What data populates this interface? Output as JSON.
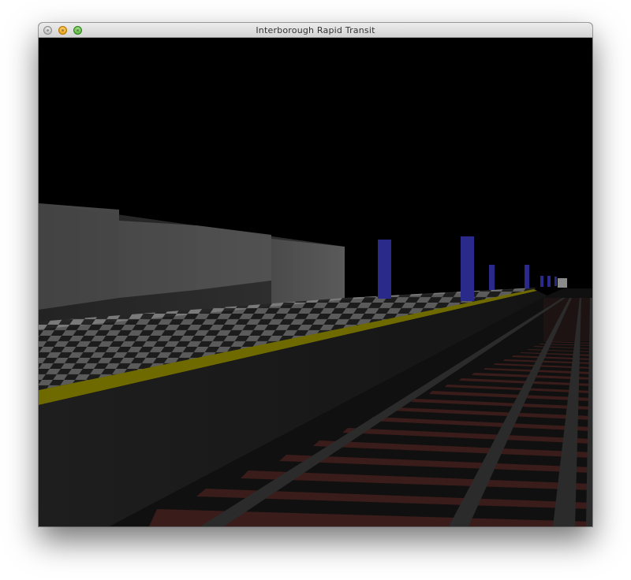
{
  "window": {
    "title": "Interborough Rapid Transit",
    "controls": [
      "close-icon",
      "minimize-icon",
      "zoom-icon"
    ]
  },
  "scene": {
    "background": "#000000",
    "colors": {
      "wall": "#4a4a4a",
      "platform_edge": "#6e6a00",
      "platform_face": "#1c1c1c",
      "track_bed": "#141414",
      "rail": "#2a2a2a",
      "tie": "#3a1c1a",
      "column": "#2a2a8a",
      "checker_light": "#7a7a7a",
      "checker_dark": "#262626"
    }
  }
}
